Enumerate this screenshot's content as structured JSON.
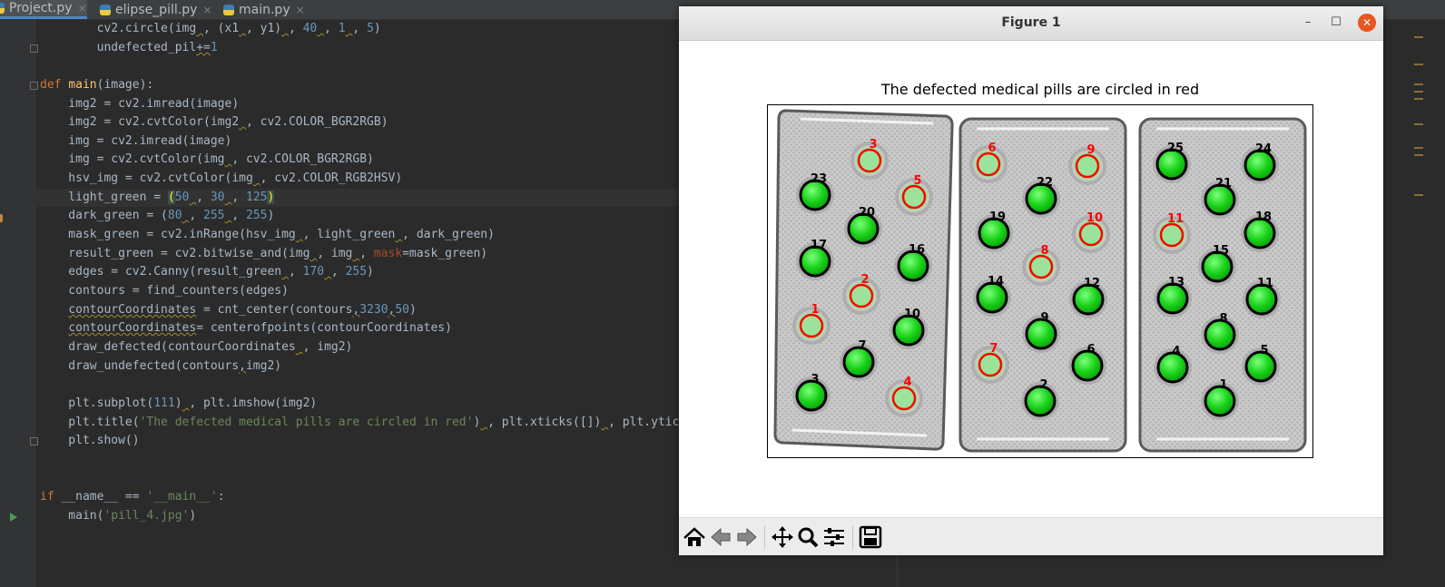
{
  "tabs": [
    {
      "label": "Project.py",
      "close": "×"
    },
    {
      "label": "elipse_pill.py",
      "close": "×"
    },
    {
      "label": "main.py",
      "close": "×"
    }
  ],
  "editor": {
    "lines": [
      "        cv2.circle(img , (x1 , y1) , 40 , 1 , 5)",
      "        undefected_pil+=1",
      "",
      "def main(image):",
      "    img2 = cv2.imread(image)",
      "    img2 = cv2.cvtColor(img2 , cv2.COLOR_BGR2RGB)",
      "    img = cv2.imread(image)",
      "    img = cv2.cvtColor(img , cv2.COLOR_BGR2RGB)",
      "    hsv_img = cv2.cvtColor(img , cv2.COLOR_RGB2HSV)",
      "    light_green = (50 , 30 , 125)",
      "    dark_green = (80 , 255 , 255)",
      "    mask_green = cv2.inRange(hsv_img , light_green , dark_green)",
      "    result_green = cv2.bitwise_and(img , img , mask=mask_green)",
      "    edges = cv2.Canny(result_green , 170 , 255)",
      "    contours = find_counters(edges)",
      "    contourCoordinates = cnt_center(contours,3230,50)",
      "    contourCoordinates= centerofpoints(contourCoordinates)",
      "    draw_defected(contourCoordinates , img2)",
      "    draw_undefected(contours,img2)",
      "",
      "    plt.subplot(111) , plt.imshow(img2)",
      "    plt.title('The defected medical pills are circled in red') , plt.xticks([]) , plt.ytic",
      "    plt.show()",
      "",
      "",
      "if __name__ == '__main__':",
      "    main('pill_4.jpg')"
    ]
  },
  "figure": {
    "window_title": "Figure 1",
    "minimize": "–",
    "maximize": "☐",
    "close": "✕",
    "plot_title": "The defected medical pills are circled in red",
    "pills": [
      {
        "pack": 1,
        "n": "3",
        "defected": true
      },
      {
        "pack": 1,
        "n": "23",
        "defected": false
      },
      {
        "pack": 1,
        "n": "5",
        "defected": true
      },
      {
        "pack": 1,
        "n": "20",
        "defected": false
      },
      {
        "pack": 1,
        "n": "17",
        "defected": false
      },
      {
        "pack": 1,
        "n": "16",
        "defected": false
      },
      {
        "pack": 1,
        "n": "2",
        "defected": true
      },
      {
        "pack": 1,
        "n": "1",
        "defected": true
      },
      {
        "pack": 1,
        "n": "10",
        "defected": false
      },
      {
        "pack": 1,
        "n": "7",
        "defected": false
      },
      {
        "pack": 1,
        "n": "3",
        "defected": false
      },
      {
        "pack": 1,
        "n": "4",
        "defected": true
      },
      {
        "pack": 2,
        "n": "6",
        "defected": true
      },
      {
        "pack": 2,
        "n": "9",
        "defected": true
      },
      {
        "pack": 2,
        "n": "22",
        "defected": false
      },
      {
        "pack": 2,
        "n": "19",
        "defected": false
      },
      {
        "pack": 2,
        "n": "10",
        "defected": true
      },
      {
        "pack": 2,
        "n": "8",
        "defected": true
      },
      {
        "pack": 2,
        "n": "14",
        "defected": false
      },
      {
        "pack": 2,
        "n": "12",
        "defected": false
      },
      {
        "pack": 2,
        "n": "9",
        "defected": false
      },
      {
        "pack": 2,
        "n": "7",
        "defected": true
      },
      {
        "pack": 2,
        "n": "6",
        "defected": false
      },
      {
        "pack": 2,
        "n": "2",
        "defected": false
      },
      {
        "pack": 3,
        "n": "25",
        "defected": false
      },
      {
        "pack": 3,
        "n": "24",
        "defected": false
      },
      {
        "pack": 3,
        "n": "21",
        "defected": false
      },
      {
        "pack": 3,
        "n": "18",
        "defected": false
      },
      {
        "pack": 3,
        "n": "11",
        "defected": true
      },
      {
        "pack": 3,
        "n": "15",
        "defected": false
      },
      {
        "pack": 3,
        "n": "13",
        "defected": false
      },
      {
        "pack": 3,
        "n": "11",
        "defected": false
      },
      {
        "pack": 3,
        "n": "8",
        "defected": false
      },
      {
        "pack": 3,
        "n": "4",
        "defected": false
      },
      {
        "pack": 3,
        "n": "5",
        "defected": false
      },
      {
        "pack": 3,
        "n": "1",
        "defected": false
      }
    ],
    "toolbar_icons": [
      "home-icon",
      "back-arrow-icon",
      "forward-arrow-icon",
      "pan-icon",
      "zoom-icon",
      "subplots-config-icon",
      "save-icon"
    ]
  },
  "colors": {
    "defect_ring": "#ff0000",
    "pill_green": "#19d219",
    "ide_bg": "#2b2b2b"
  }
}
